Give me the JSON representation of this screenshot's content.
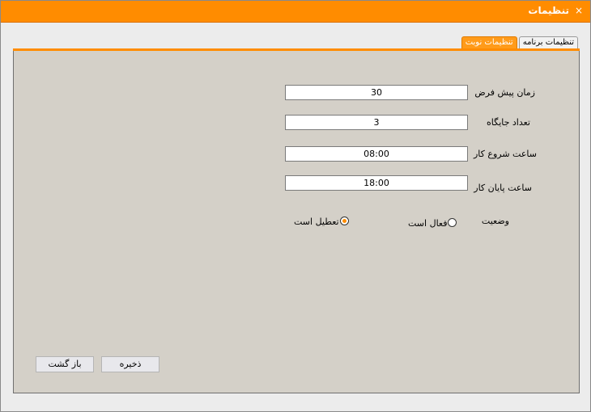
{
  "window": {
    "title": "تنظیمات",
    "close_glyph": "×"
  },
  "tabs": [
    {
      "label": "تنظیمات نوبت",
      "active": true
    },
    {
      "label": "تنظیمات برنامه",
      "active": false
    }
  ],
  "form": {
    "default_time": {
      "label": "زمان پیش فرض",
      "value": "30"
    },
    "slot_count": {
      "label": "تعداد جایگاه",
      "value": "3"
    },
    "start_time": {
      "label": "ساعت شروع کار",
      "value": "08:00"
    },
    "end_time": {
      "label": "ساعت پایان کار",
      "value": "18:00"
    },
    "status": {
      "label": "وضعیت",
      "options": [
        {
          "label": "فعال است",
          "selected": false
        },
        {
          "label": "تعطیل است",
          "selected": true
        }
      ]
    }
  },
  "buttons": {
    "save_label": "ذخیره",
    "back_label": "باز گشت"
  },
  "colors": {
    "accent": "#ff8c00",
    "panel_bg": "#d4d0c8"
  }
}
